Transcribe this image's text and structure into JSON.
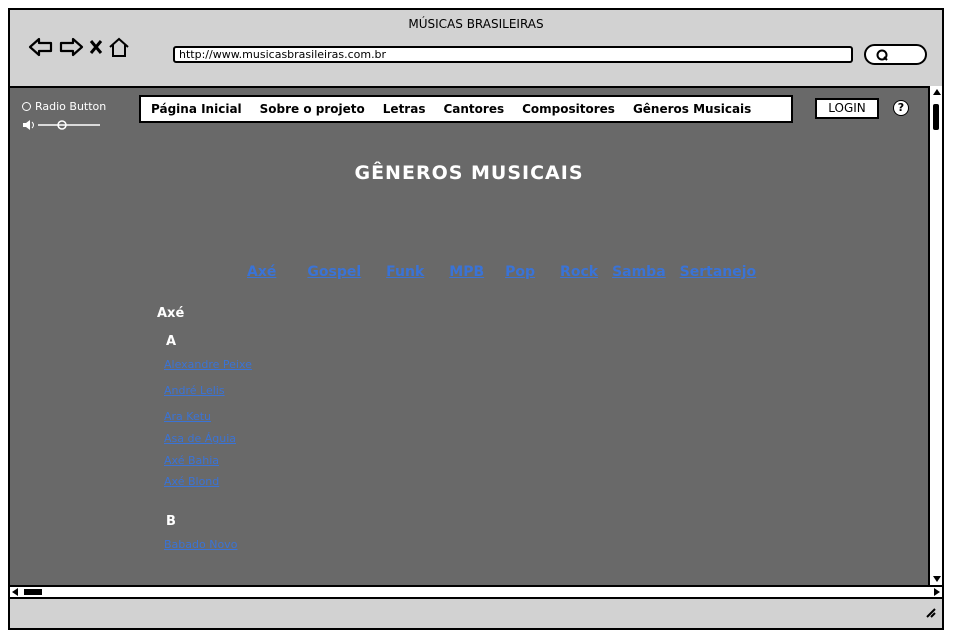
{
  "window": {
    "title": "MÚSICAS BRASILEIRAS"
  },
  "toolbar": {
    "url": "http://www.musicasbrasileiras.com.br"
  },
  "sidebar": {
    "radio_label": "Radio Button"
  },
  "menu": {
    "items": [
      "Página Inicial",
      "Sobre o projeto",
      "Letras",
      "Cantores",
      "Compositores",
      "Gêneros Musicais"
    ]
  },
  "auth": {
    "login_label": "LOGIN"
  },
  "help": {
    "label": "?"
  },
  "page": {
    "heading": "GÊNEROS MUSICAIS",
    "genres": [
      "Axé",
      "Gospel",
      "Funk",
      "MPB",
      "Pop",
      "Rock",
      "Samba",
      "Sertanejo"
    ],
    "section_title": "Axé",
    "groups": [
      {
        "letter": "A",
        "artists": [
          "Alexandre Peixe",
          "André Lelis",
          "Ara Ketu",
          "Asa de Águia",
          "Axé Bahia",
          "Axé Blond"
        ]
      },
      {
        "letter": "B",
        "artists": [
          "Babado Novo"
        ]
      }
    ]
  },
  "colors": {
    "background": "#696969",
    "link": "#3a73d6",
    "chrome": "#d2d2d2"
  }
}
